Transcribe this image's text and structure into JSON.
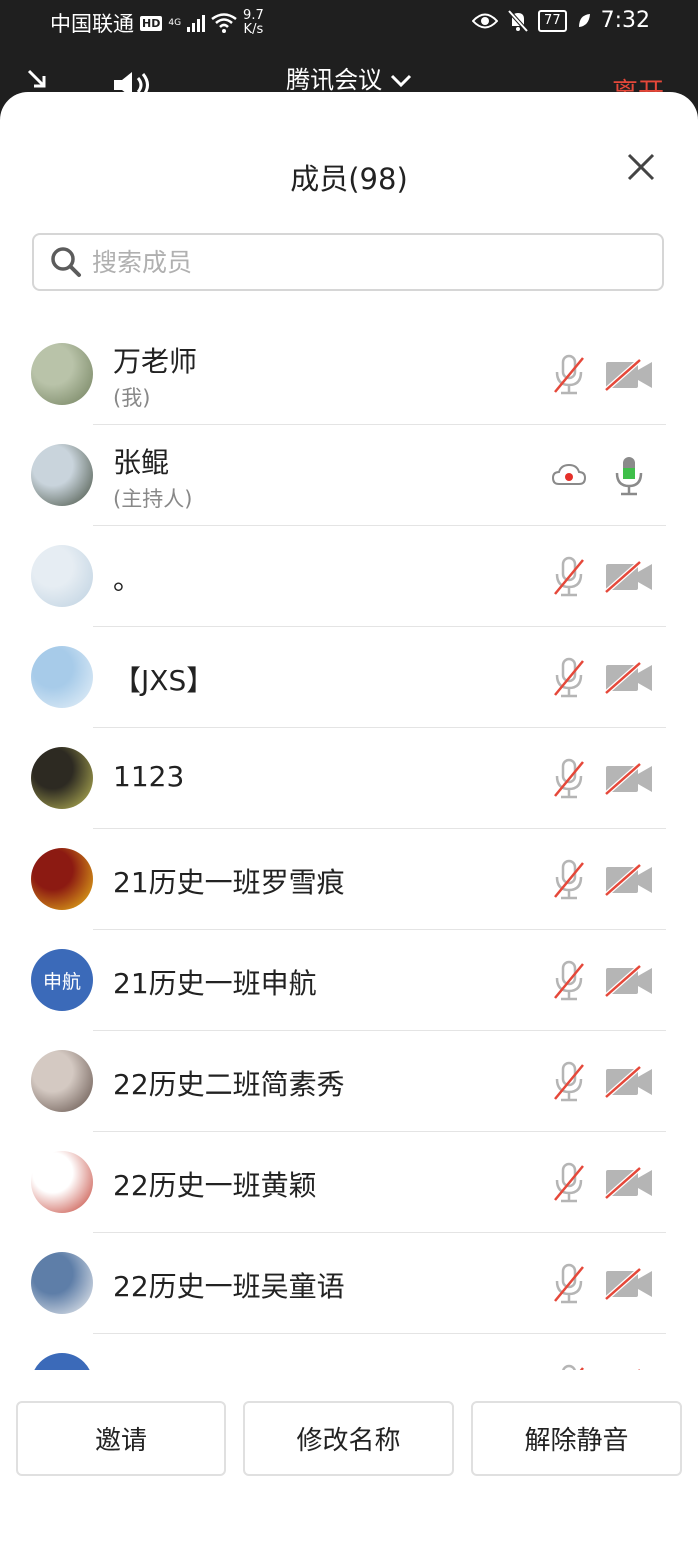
{
  "status_bar": {
    "carrier": "中国联通",
    "hd": "HD",
    "network": "4G",
    "speed_value": "9.7",
    "speed_unit": "K/s",
    "battery": "77",
    "time": "7:32"
  },
  "header": {
    "meeting_title": "腾讯会议",
    "leave_label": "离开"
  },
  "panel": {
    "title": "成员(98)"
  },
  "search": {
    "placeholder": "搜索成员"
  },
  "members": [
    {
      "name": "万老师",
      "sub": "(我)",
      "avatar_type": "photo",
      "avatar_colors": [
        "#b9c3a9",
        "#6e7d5a"
      ],
      "mic": "muted",
      "camera": "off"
    },
    {
      "name": "张鲲",
      "sub": "(主持人)",
      "avatar_type": "photo",
      "avatar_colors": [
        "#c9d4dc",
        "#3f4a3a"
      ],
      "mic": "active",
      "camera": "cloud-recording"
    },
    {
      "name": "。",
      "sub": "",
      "avatar_type": "photo",
      "avatar_colors": [
        "#e6edf3",
        "#bcd0e0"
      ],
      "mic": "muted",
      "camera": "off"
    },
    {
      "name": "【JXS】",
      "sub": "",
      "avatar_type": "photo",
      "avatar_colors": [
        "#a7cbe9",
        "#e9f2f9"
      ],
      "mic": "muted",
      "camera": "off"
    },
    {
      "name": "1123",
      "sub": "",
      "avatar_type": "photo",
      "avatar_colors": [
        "#2d2a22",
        "#c4c15a"
      ],
      "mic": "muted",
      "camera": "off"
    },
    {
      "name": "21历史一班罗雪痕",
      "sub": "",
      "avatar_type": "photo",
      "avatar_colors": [
        "#8c1a12",
        "#f0c21a"
      ],
      "mic": "muted",
      "camera": "off"
    },
    {
      "name": "21历史一班申航",
      "sub": "",
      "avatar_type": "initials",
      "avatar_text": "申航",
      "avatar_colors": [
        "#3b6ab9",
        "#3b6ab9"
      ],
      "mic": "muted",
      "camera": "off"
    },
    {
      "name": "22历史二班简素秀",
      "sub": "",
      "avatar_type": "photo",
      "avatar_colors": [
        "#d4c9c2",
        "#5b4a43"
      ],
      "mic": "muted",
      "camera": "off"
    },
    {
      "name": "22历史一班黄颖",
      "sub": "",
      "avatar_type": "photo",
      "avatar_colors": [
        "#ffffff",
        "#c0372a"
      ],
      "mic": "muted",
      "camera": "off"
    },
    {
      "name": "22历史一班吴童语",
      "sub": "",
      "avatar_type": "photo",
      "avatar_colors": [
        "#5e7ea8",
        "#f4f4f4"
      ],
      "mic": "muted",
      "camera": "off"
    },
    {
      "name": "",
      "sub": "",
      "avatar_type": "initials",
      "avatar_text": "",
      "avatar_colors": [
        "#3b6ab9",
        "#3b6ab9"
      ],
      "mic": "muted",
      "camera": "off"
    }
  ],
  "actions": {
    "invite": "邀请",
    "rename": "修改名称",
    "unmute": "解除静音"
  },
  "colors": {
    "leave": "#e5483a",
    "muted_slash": "#e5483a",
    "mic_active": "#3fbf4a",
    "icon_gray": "#b5b5b5",
    "initials_bg": "#3b6ab9"
  }
}
